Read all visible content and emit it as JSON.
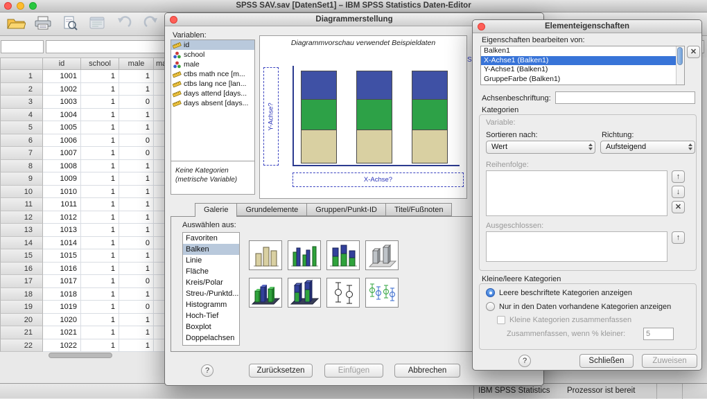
{
  "main_window": {
    "title": "SPSS SAV.sav [DatenSet1] – IBM SPSS Statistics Daten-Editor",
    "status": {
      "brand": "IBM SPSS Statistics",
      "message": "Prozessor ist bereit"
    },
    "grid": {
      "columns": [
        "id",
        "school",
        "male",
        "ma"
      ],
      "rows": [
        {
          "n": "1",
          "id": "1001",
          "school": "1",
          "male": "1",
          "ma": ""
        },
        {
          "n": "2",
          "id": "1002",
          "school": "1",
          "male": "1",
          "ma": ""
        },
        {
          "n": "3",
          "id": "1003",
          "school": "1",
          "male": "0",
          "ma": ""
        },
        {
          "n": "4",
          "id": "1004",
          "school": "1",
          "male": "1",
          "ma": ""
        },
        {
          "n": "5",
          "id": "1005",
          "school": "1",
          "male": "1",
          "ma": ""
        },
        {
          "n": "6",
          "id": "1006",
          "school": "1",
          "male": "0",
          "ma": ""
        },
        {
          "n": "7",
          "id": "1007",
          "school": "1",
          "male": "0",
          "ma": ""
        },
        {
          "n": "8",
          "id": "1008",
          "school": "1",
          "male": "1",
          "ma": ""
        },
        {
          "n": "9",
          "id": "1009",
          "school": "1",
          "male": "1",
          "ma": ""
        },
        {
          "n": "10",
          "id": "1010",
          "school": "1",
          "male": "1",
          "ma": ""
        },
        {
          "n": "11",
          "id": "1011",
          "school": "1",
          "male": "1",
          "ma": ""
        },
        {
          "n": "12",
          "id": "1012",
          "school": "1",
          "male": "1",
          "ma": ""
        },
        {
          "n": "13",
          "id": "1013",
          "school": "1",
          "male": "1",
          "ma": ""
        },
        {
          "n": "14",
          "id": "1014",
          "school": "1",
          "male": "0",
          "ma": ""
        },
        {
          "n": "15",
          "id": "1015",
          "school": "1",
          "male": "1",
          "ma": ""
        },
        {
          "n": "16",
          "id": "1016",
          "school": "1",
          "male": "1",
          "ma": ""
        },
        {
          "n": "17",
          "id": "1017",
          "school": "1",
          "male": "0",
          "ma": ""
        },
        {
          "n": "18",
          "id": "1018",
          "school": "1",
          "male": "1",
          "ma": ""
        },
        {
          "n": "19",
          "id": "1019",
          "school": "1",
          "male": "0",
          "ma": ""
        },
        {
          "n": "20",
          "id": "1020",
          "school": "1",
          "male": "1",
          "ma": ""
        },
        {
          "n": "21",
          "id": "1021",
          "school": "1",
          "male": "1",
          "ma": ""
        },
        {
          "n": "22",
          "id": "1022",
          "school": "1",
          "male": "1",
          "ma": ""
        }
      ]
    }
  },
  "chart_builder": {
    "title": "Diagrammerstellung",
    "variables_label": "Variablen:",
    "variables": [
      {
        "label": "id",
        "type": "scale",
        "selected": true
      },
      {
        "label": "school",
        "type": "nominal",
        "selected": false
      },
      {
        "label": "male",
        "type": "nominal",
        "selected": false
      },
      {
        "label": "ctbs math nce [m...",
        "type": "scale",
        "selected": false
      },
      {
        "label": "ctbs lang nce [lan...",
        "type": "scale",
        "selected": false
      },
      {
        "label": "days attend [days...",
        "type": "scale",
        "selected": false
      },
      {
        "label": "days absent [days...",
        "type": "scale",
        "selected": false
      }
    ],
    "categories_note_line1": "Keine Kategorien",
    "categories_note_line2": "(metrische Variable)",
    "preview": {
      "caption": "Diagrammvorschau verwendet Beispieldaten",
      "y_axis_drop": "Y-Achse?",
      "x_axis_drop": "X-Achse?",
      "clipped_right_text": "Sta"
    },
    "tabs": [
      {
        "label": "Galerie",
        "active": true
      },
      {
        "label": "Grundelemente",
        "active": false
      },
      {
        "label": "Gruppen/Punkt-ID",
        "active": false
      },
      {
        "label": "Titel/Fußnoten",
        "active": false
      }
    ],
    "choose_from_label": "Auswählen aus:",
    "gallery_categories": [
      {
        "label": "Favoriten",
        "selected": false
      },
      {
        "label": "Balken",
        "selected": true
      },
      {
        "label": "Linie",
        "selected": false
      },
      {
        "label": "Fläche",
        "selected": false
      },
      {
        "label": "Kreis/Polar",
        "selected": false
      },
      {
        "label": "Streu-/Punktd...",
        "selected": false
      },
      {
        "label": "Histogramm",
        "selected": false
      },
      {
        "label": "Hoch-Tief",
        "selected": false
      },
      {
        "label": "Boxplot",
        "selected": false
      },
      {
        "label": "Doppelachsen",
        "selected": false
      }
    ],
    "gallery_thumbnails": [
      "simple-bar",
      "clustered-bar",
      "stacked-bar",
      "3d-bar",
      "3d-clustered-bar",
      "3d-stacked-bar",
      "error-bar",
      "clustered-error-bar"
    ],
    "buttons": {
      "help": "?",
      "reset": "Zurücksetzen",
      "paste": "Einfügen",
      "cancel": "Abbrechen"
    }
  },
  "element_properties": {
    "title": "Elementeigenschaften",
    "edit_properties_label": "Eigenschaften bearbeiten von:",
    "property_items": [
      {
        "label": "Balken1",
        "selected": false
      },
      {
        "label": "X-Achse1 (Balken1)",
        "selected": true
      },
      {
        "label": "Y-Achse1 (Balken1)",
        "selected": false
      },
      {
        "label": "GruppeFarbe (Balken1)",
        "selected": false
      }
    ],
    "axis_label_label": "Achsenbeschriftung:",
    "axis_label_value": "",
    "categories": {
      "group_title": "Kategorien",
      "variable_label": "Variable:",
      "sort_by_label": "Sortieren nach:",
      "sort_by_value": "Wert",
      "direction_label": "Richtung:",
      "direction_value": "Aufsteigend",
      "order_label": "Reihenfolge:",
      "excluded_label": "Ausgeschlossen:"
    },
    "small_empty": {
      "group_title": "Kleine/leere Kategorien",
      "radio_show_empty": "Leere beschriftete Kategorien anzeigen",
      "radio_data_only": "Nur in den Daten vorhandene Kategorien anzeigen",
      "checkbox_collapse": "Kleine Kategorien zusammenfassen",
      "collapse_threshold_label": "Zusammenfassen, wenn % kleiner:",
      "collapse_threshold_value": "5"
    },
    "buttons": {
      "help": "?",
      "close": "Schließen",
      "apply": "Zuweisen"
    }
  },
  "colors": {
    "selection_blue": "#3874d8",
    "inactive_selection": "#b9c9dc",
    "bar_blue": "#3f51a5",
    "bar_green": "#2da147",
    "bar_tan": "#d9d0a2",
    "dropzone_blue": "#2a33b8"
  }
}
